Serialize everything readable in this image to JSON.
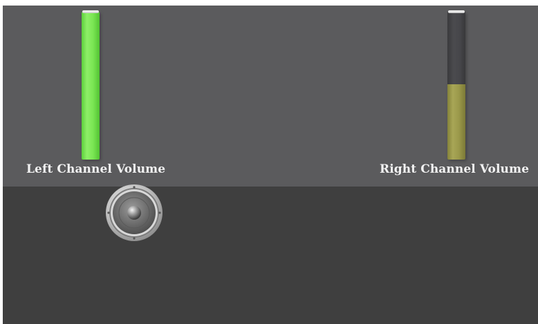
{
  "channels": {
    "left": {
      "label": "Left Channel Volume",
      "level": 1.0,
      "color": "#79e552"
    },
    "right": {
      "label": "Right Channel Volume",
      "level": 0.51,
      "color": "#9a984a"
    }
  },
  "speaker": {
    "icon": "speaker-icon"
  },
  "colors": {
    "top_panel": "#5b5b5d",
    "bottom_panel": "#3f3f3f",
    "label_text": "#f2f2f2"
  }
}
